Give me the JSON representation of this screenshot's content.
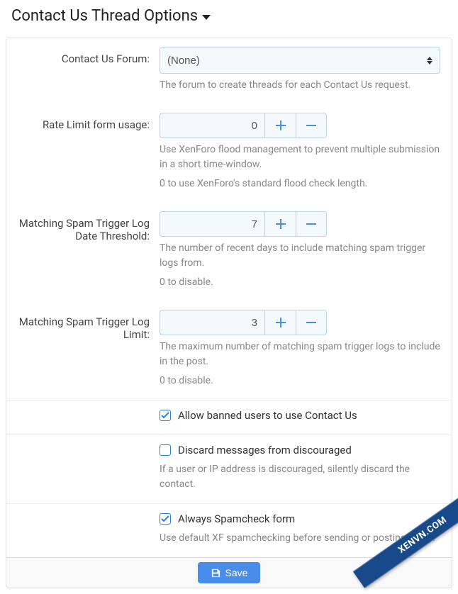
{
  "title": "Contact Us Thread Options",
  "forum": {
    "label": "Contact Us Forum:",
    "value": "(None)",
    "helper": "The forum to create threads for each Contact Us request."
  },
  "rate_limit": {
    "label": "Rate Limit form usage:",
    "value": "0",
    "helper1": "Use XenForo flood management to prevent multiple submission in a short time-window.",
    "helper2": "0 to use XenForo's standard flood check length."
  },
  "spam_date": {
    "label": "Matching Spam Trigger Log Date Threshold:",
    "value": "7",
    "helper1": "The number of recent days to include matching spam trigger logs from.",
    "helper2": "0 to disable."
  },
  "spam_limit": {
    "label": "Matching Spam Trigger Log Limit:",
    "value": "3",
    "helper1": "The maximum number of matching spam trigger logs to include in the post.",
    "helper2": "0 to disable."
  },
  "opts": {
    "allow_banned": "Allow banned users to use Contact Us",
    "discard_discouraged": "Discard messages from discouraged",
    "discard_helper": "If a user or IP address is discouraged, silently discard the contact.",
    "always_spamcheck": "Always Spamcheck form",
    "spamcheck_helper": "Use default XF spamchecking before sending or posting email."
  },
  "save": "Save",
  "ribbon": "XENVN.COM"
}
